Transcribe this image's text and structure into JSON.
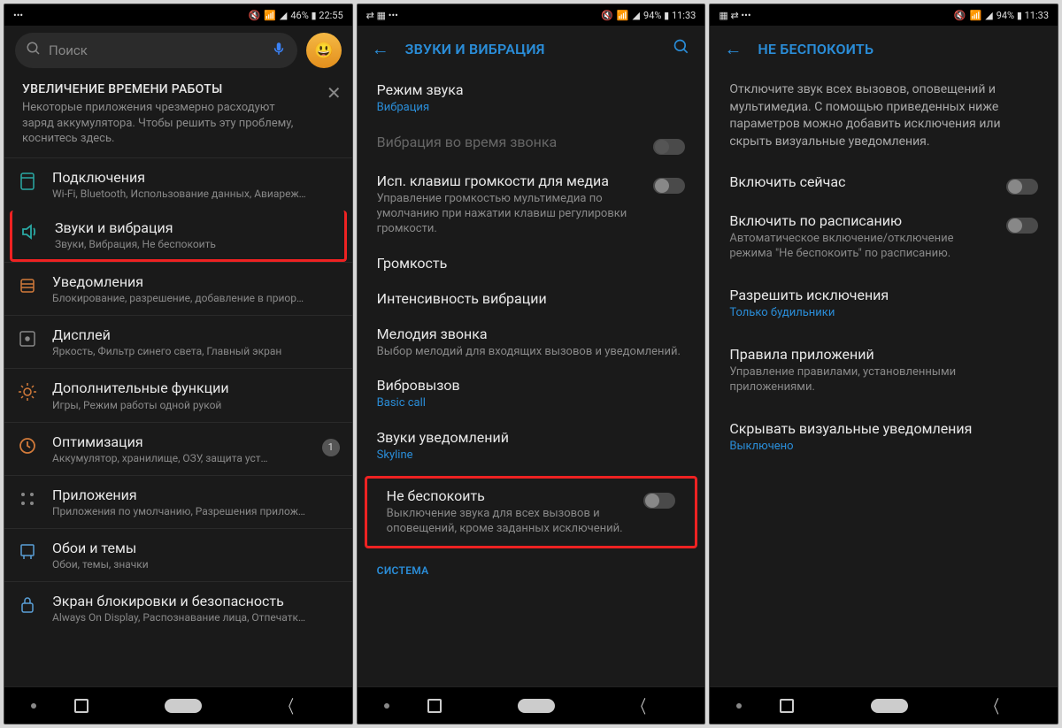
{
  "screen1": {
    "status": {
      "left_icons": "•••",
      "right": "46% ▮ 22:55",
      "mute_icon": "🔇",
      "signal_icon": "📶"
    },
    "search_placeholder": "Поиск",
    "notice": {
      "title": "УВЕЛИЧЕНИЕ ВРЕМЕНИ РАБОТЫ",
      "body": "Некоторые приложения чрезмерно расходуют заряд аккумулятора. Чтобы решить эту проблему, коснитесь здесь."
    },
    "items": [
      {
        "title": "Подключения",
        "sub": "Wi-Fi, Bluetooth, Использование данных, Авиареж…"
      },
      {
        "title": "Звуки и вибрация",
        "sub": "Звуки, Вибрация, Не беспокоить"
      },
      {
        "title": "Уведомления",
        "sub": "Блокирование, разрешение, добавление в приор…"
      },
      {
        "title": "Дисплей",
        "sub": "Яркость, Фильтр синего света, Главный экран"
      },
      {
        "title": "Дополнительные функции",
        "sub": "Игры, Режим работы одной рукой"
      },
      {
        "title": "Оптимизация",
        "sub": "Аккумулятор, хранилище, ОЗУ, защита уст…",
        "badge": "1"
      },
      {
        "title": "Приложения",
        "sub": "Приложения по умолчанию, Разрешения прилож…"
      },
      {
        "title": "Обои и темы",
        "sub": "Обои, темы, значки"
      },
      {
        "title": "Экран блокировки и безопасность",
        "sub": "Always On Display, Распознавание лица, Отпечатк…"
      }
    ]
  },
  "screen2": {
    "status": {
      "left_icons": "⇄ ▦ •••",
      "right": "94% ▮ 11:33"
    },
    "header": "ЗВУКИ И ВИБРАЦИЯ",
    "rows": [
      {
        "title": "Режим звука",
        "sub": "Вибрация",
        "subBlue": true
      },
      {
        "title": "Вибрация во время звонка",
        "disabled": true,
        "toggle": true
      },
      {
        "title": "Исп. клавиш громкости для медиа",
        "sub": "Управление громкостью мультимедиа по умолчанию при нажатии клавиш регулировки громкости.",
        "toggle": true
      },
      {
        "title": "Громкость"
      },
      {
        "title": "Интенсивность вибрации"
      },
      {
        "title": "Мелодия звонка",
        "sub": "Выбор мелодий для входящих вызовов и уведомлений."
      },
      {
        "title": "Вибровызов",
        "sub": "Basic call",
        "subBlue": true
      },
      {
        "title": "Звуки уведомлений",
        "sub": "Skyline",
        "subBlue": true
      },
      {
        "title": "Не беспокоить",
        "sub": "Выключение звука для всех вызовов и оповещений, кроме заданных исключений.",
        "toggle": true,
        "highlight": true
      }
    ],
    "section_system": "СИСТЕМА"
  },
  "screen3": {
    "status": {
      "left_icons": "▦ ⇄ •••",
      "right": "94% ▮ 11:33"
    },
    "header": "НЕ БЕСПОКОИТЬ",
    "intro": "Отключите звук всех вызовов, оповещений и мультимедиа. С помощью приведенных ниже параметров можно добавить исключения или скрыть визуальные уведомления.",
    "rows": [
      {
        "title": "Включить сейчас",
        "toggle": true
      },
      {
        "title": "Включить по расписанию",
        "sub": "Автоматическое включение/отключение режима \"Не беспокоить\" по расписанию.",
        "toggle": true
      },
      {
        "title": "Разрешить исключения",
        "sub": "Только будильники",
        "subBlue": true
      },
      {
        "title": "Правила приложений",
        "sub": "Управление правилами, установленными приложениями."
      },
      {
        "title": "Скрывать визуальные уведомления",
        "sub": "Выключено",
        "subBlue": true
      }
    ]
  }
}
